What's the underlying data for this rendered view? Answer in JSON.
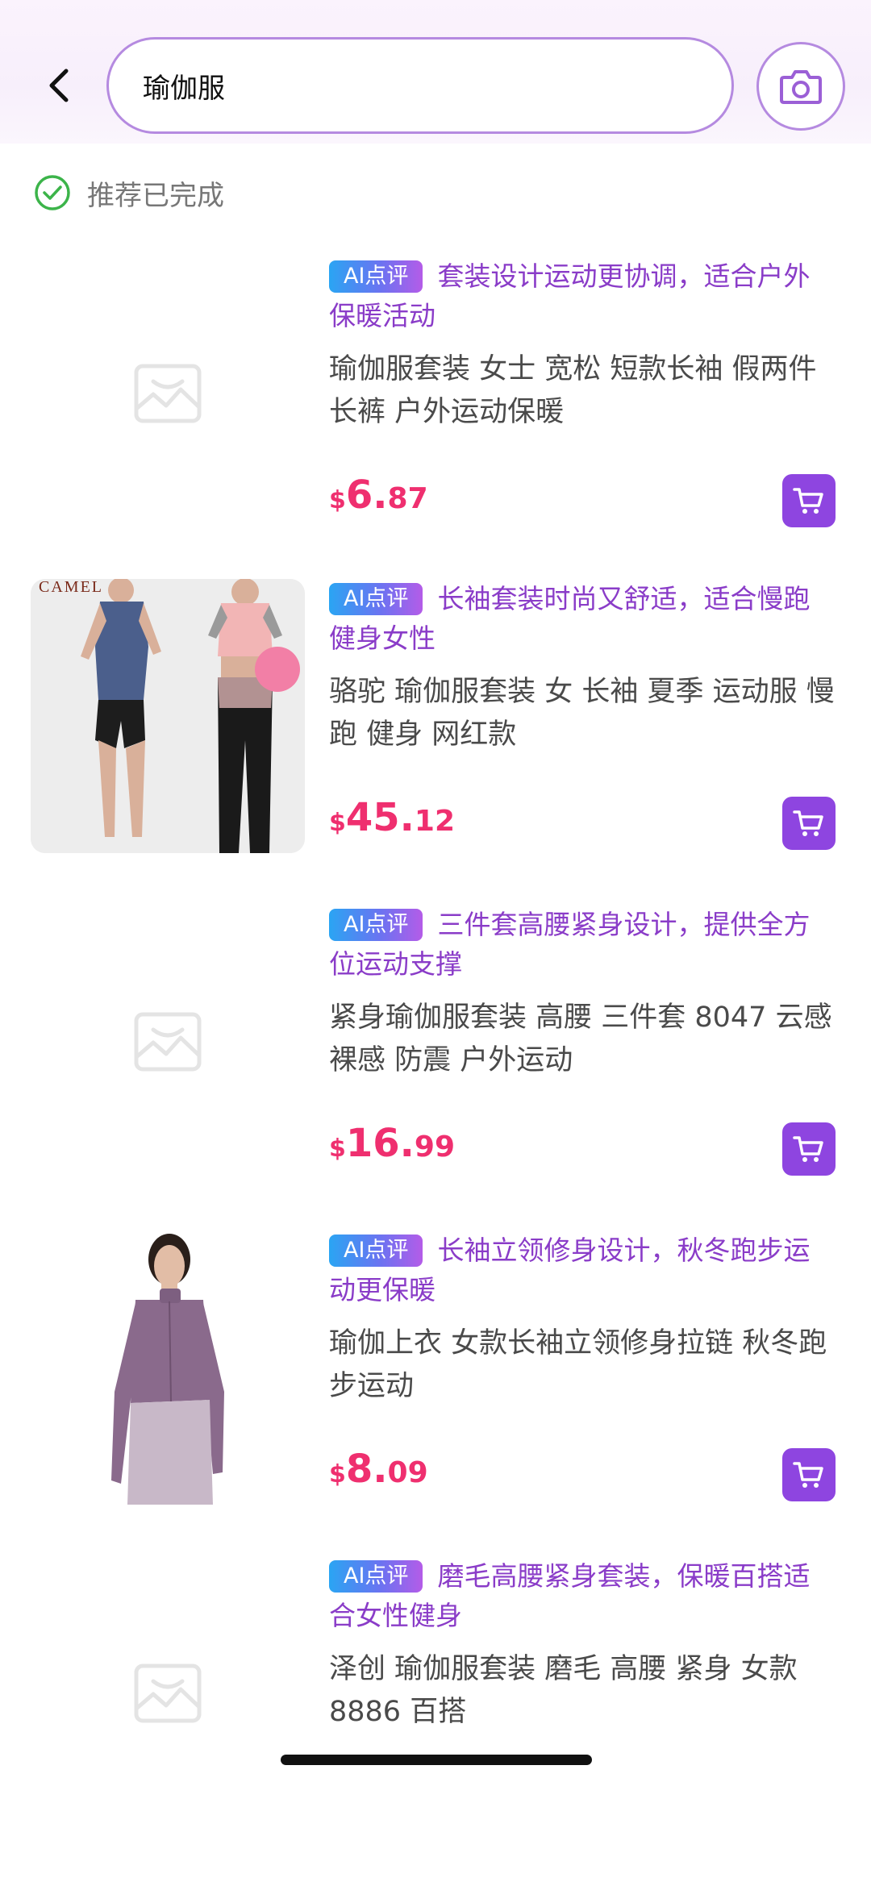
{
  "search": {
    "query": "瑜伽服"
  },
  "status": {
    "text": "推荐已完成"
  },
  "colors": {
    "accent": "#8e45e0",
    "price": "#ef2f6f",
    "ai_text": "#8a3cc8",
    "check": "#3cb44a"
  },
  "products": [
    {
      "badge": "AI点评",
      "ai_comment": "套装设计运动更协调，适合户外保暖活动",
      "title": "瑜伽服套装 女士 宽松 短款长袖 假两件长裤 户外运动保暖",
      "price": {
        "currency": "$",
        "int": "6.",
        "dec": "87"
      },
      "image": "placeholder-image-icon"
    },
    {
      "badge": "AI点评",
      "ai_comment": "长袖套装时尚又舒适，适合慢跑健身女性",
      "title": "骆驼 瑜伽服套装 女 长袖 夏季 运动服 慢跑 健身 网红款",
      "price": {
        "currency": "$",
        "int": "45.",
        "dec": "12"
      },
      "image": "product-photo-camel-sportswear",
      "image_brand_text": "CAMEL"
    },
    {
      "badge": "AI点评",
      "ai_comment": "三件套高腰紧身设计，提供全方位运动支撑",
      "title": "紧身瑜伽服套装 高腰 三件套 8047 云感裸感 防震 户外运动",
      "price": {
        "currency": "$",
        "int": "16.",
        "dec": "99"
      },
      "image": "placeholder-image-icon"
    },
    {
      "badge": "AI点评",
      "ai_comment": "长袖立领修身设计，秋冬跑步运动更保暖",
      "title": "瑜伽上衣 女款长袖立领修身拉链 秋冬跑步运动",
      "price": {
        "currency": "$",
        "int": "8.",
        "dec": "09"
      },
      "image": "product-photo-purple-jacket"
    },
    {
      "badge": "AI点评",
      "ai_comment": "磨毛高腰紧身套装，保暖百搭适合女性健身",
      "title": "泽创 瑜伽服套装 磨毛 高腰 紧身 女款 8886 百搭",
      "image": "placeholder-image-icon"
    }
  ]
}
